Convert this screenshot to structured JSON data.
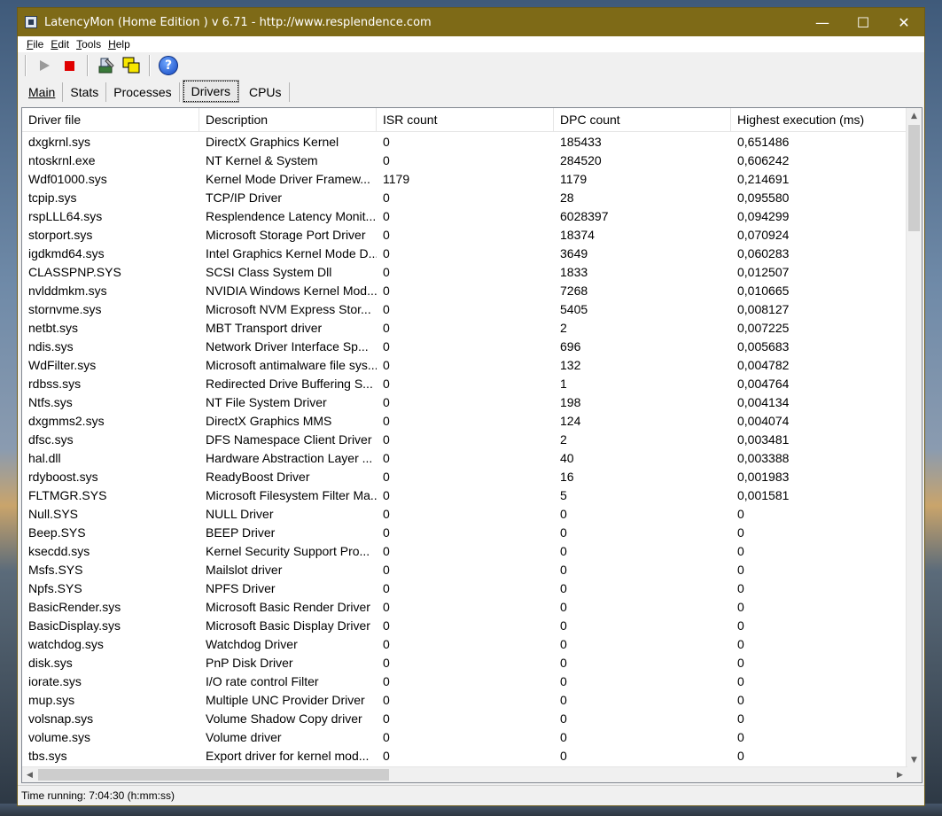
{
  "window": {
    "title": "LatencyMon  (Home Edition )  v 6.71 - http://www.resplendence.com",
    "controls": {
      "minimize": "—",
      "maximize": "☐",
      "close": "✕"
    },
    "title_bar_color": "#7e6a17"
  },
  "menu": [
    {
      "underline": "F",
      "rest": "ile"
    },
    {
      "underline": "E",
      "rest": "dit"
    },
    {
      "underline": "T",
      "rest": "ools"
    },
    {
      "underline": "H",
      "rest": "elp"
    }
  ],
  "toolbar": {
    "icons": [
      "play-icon",
      "stop-icon",
      "driver-config-icon",
      "window-icon",
      "help-icon"
    ],
    "help_glyph": "?"
  },
  "tabs": [
    {
      "label": "Main",
      "active": false
    },
    {
      "label": "Stats",
      "active": false
    },
    {
      "label": "Processes",
      "active": false
    },
    {
      "label": "Drivers",
      "active": true
    },
    {
      "label": "CPUs",
      "active": false
    }
  ],
  "table": {
    "columns": [
      "Driver file",
      "Description",
      "ISR count",
      "DPC count",
      "Highest execution (ms)"
    ],
    "rows": [
      [
        "dxgkrnl.sys",
        "DirectX Graphics Kernel",
        "0",
        "185433",
        "0,651486"
      ],
      [
        "ntoskrnl.exe",
        "NT Kernel & System",
        "0",
        "284520",
        "0,606242"
      ],
      [
        "Wdf01000.sys",
        "Kernel Mode Driver Framew...",
        "1179",
        "1179",
        "0,214691"
      ],
      [
        "tcpip.sys",
        "TCP/IP Driver",
        "0",
        "28",
        "0,095580"
      ],
      [
        "rspLLL64.sys",
        "Resplendence Latency Monit...",
        "0",
        "6028397",
        "0,094299"
      ],
      [
        "storport.sys",
        "Microsoft Storage Port Driver",
        "0",
        "18374",
        "0,070924"
      ],
      [
        "igdkmd64.sys",
        "Intel Graphics Kernel Mode D...",
        "0",
        "3649",
        "0,060283"
      ],
      [
        "CLASSPNP.SYS",
        "SCSI Class System Dll",
        "0",
        "1833",
        "0,012507"
      ],
      [
        "nvlddmkm.sys",
        "NVIDIA Windows Kernel Mod...",
        "0",
        "7268",
        "0,010665"
      ],
      [
        "stornvme.sys",
        "Microsoft NVM Express Stor...",
        "0",
        "5405",
        "0,008127"
      ],
      [
        "netbt.sys",
        "MBT Transport driver",
        "0",
        "2",
        "0,007225"
      ],
      [
        "ndis.sys",
        "Network Driver Interface Sp...",
        "0",
        "696",
        "0,005683"
      ],
      [
        "WdFilter.sys",
        "Microsoft antimalware file sys...",
        "0",
        "132",
        "0,004782"
      ],
      [
        "rdbss.sys",
        "Redirected Drive Buffering S...",
        "0",
        "1",
        "0,004764"
      ],
      [
        "Ntfs.sys",
        "NT File System Driver",
        "0",
        "198",
        "0,004134"
      ],
      [
        "dxgmms2.sys",
        "DirectX Graphics MMS",
        "0",
        "124",
        "0,004074"
      ],
      [
        "dfsc.sys",
        "DFS Namespace Client Driver",
        "0",
        "2",
        "0,003481"
      ],
      [
        "hal.dll",
        "Hardware Abstraction Layer ...",
        "0",
        "40",
        "0,003388"
      ],
      [
        "rdyboost.sys",
        "ReadyBoost Driver",
        "0",
        "16",
        "0,001983"
      ],
      [
        "FLTMGR.SYS",
        "Microsoft Filesystem Filter Ma...",
        "0",
        "5",
        "0,001581"
      ],
      [
        "Null.SYS",
        "NULL Driver",
        "0",
        "0",
        "0"
      ],
      [
        "Beep.SYS",
        "BEEP Driver",
        "0",
        "0",
        "0"
      ],
      [
        "ksecdd.sys",
        "Kernel Security Support Pro...",
        "0",
        "0",
        "0"
      ],
      [
        "Msfs.SYS",
        "Mailslot driver",
        "0",
        "0",
        "0"
      ],
      [
        "Npfs.SYS",
        "NPFS Driver",
        "0",
        "0",
        "0"
      ],
      [
        "BasicRender.sys",
        "Microsoft Basic Render Driver",
        "0",
        "0",
        "0"
      ],
      [
        "BasicDisplay.sys",
        "Microsoft Basic Display Driver",
        "0",
        "0",
        "0"
      ],
      [
        "watchdog.sys",
        "Watchdog Driver",
        "0",
        "0",
        "0"
      ],
      [
        "disk.sys",
        "PnP Disk Driver",
        "0",
        "0",
        "0"
      ],
      [
        "iorate.sys",
        "I/O rate control Filter",
        "0",
        "0",
        "0"
      ],
      [
        "mup.sys",
        "Multiple UNC Provider Driver",
        "0",
        "0",
        "0"
      ],
      [
        "volsnap.sys",
        "Volume Shadow Copy driver",
        "0",
        "0",
        "0"
      ],
      [
        "volume.sys",
        "Volume driver",
        "0",
        "0",
        "0"
      ],
      [
        "tbs.sys",
        "Export driver for kernel mod...",
        "0",
        "0",
        "0"
      ]
    ]
  },
  "statusbar": {
    "text": "Time running: 7:04:30  (h:mm:ss)"
  }
}
